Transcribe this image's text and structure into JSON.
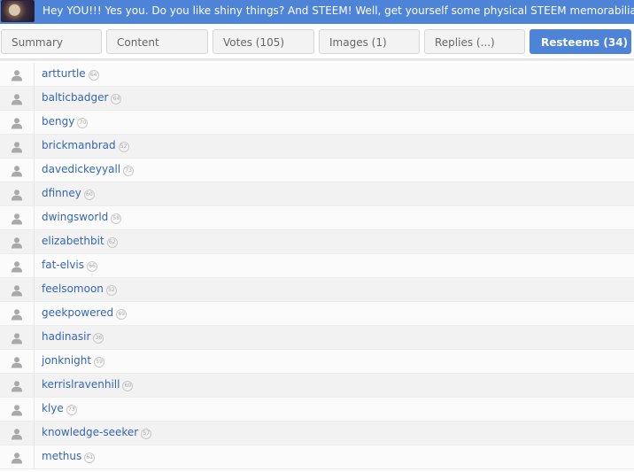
{
  "banner": {
    "text": "Hey YOU!!! Yes you. Do you like shiny things? And STEEM! Well, get yourself some physical STEEM memorabilia before"
  },
  "tabs": [
    {
      "label": "Summary",
      "active": false
    },
    {
      "label": "Content",
      "active": false
    },
    {
      "label": "Votes (105)",
      "active": false
    },
    {
      "label": "Images (1)",
      "active": false
    },
    {
      "label": "Replies (...)",
      "active": false
    },
    {
      "label": "Resteems (34)",
      "active": true
    }
  ],
  "resteems": [
    {
      "username": "artturtle",
      "reputation": "64"
    },
    {
      "username": "balticbadger",
      "reputation": "64"
    },
    {
      "username": "bengy",
      "reputation": "70"
    },
    {
      "username": "brickmanbrad",
      "reputation": "52"
    },
    {
      "username": "davedickeyyall",
      "reputation": "73"
    },
    {
      "username": "dfinney",
      "reputation": "60"
    },
    {
      "username": "dwingsworld",
      "reputation": "58"
    },
    {
      "username": "elizabethbit",
      "reputation": "62"
    },
    {
      "username": "fat-elvis",
      "reputation": "66"
    },
    {
      "username": "feelsomoon",
      "reputation": "52"
    },
    {
      "username": "geekpowered",
      "reputation": "69"
    },
    {
      "username": "hadinasir",
      "reputation": "36"
    },
    {
      "username": "jonknight",
      "reputation": "59"
    },
    {
      "username": "kerrislravenhill",
      "reputation": "60"
    },
    {
      "username": "klye",
      "reputation": "73"
    },
    {
      "username": "knowledge-seeker",
      "reputation": "57"
    },
    {
      "username": "methus",
      "reputation": "61"
    }
  ],
  "colors": {
    "accent": "#4d84d8",
    "link": "#3466b6"
  },
  "icons": {
    "avatar": "user-avatar-icon"
  }
}
